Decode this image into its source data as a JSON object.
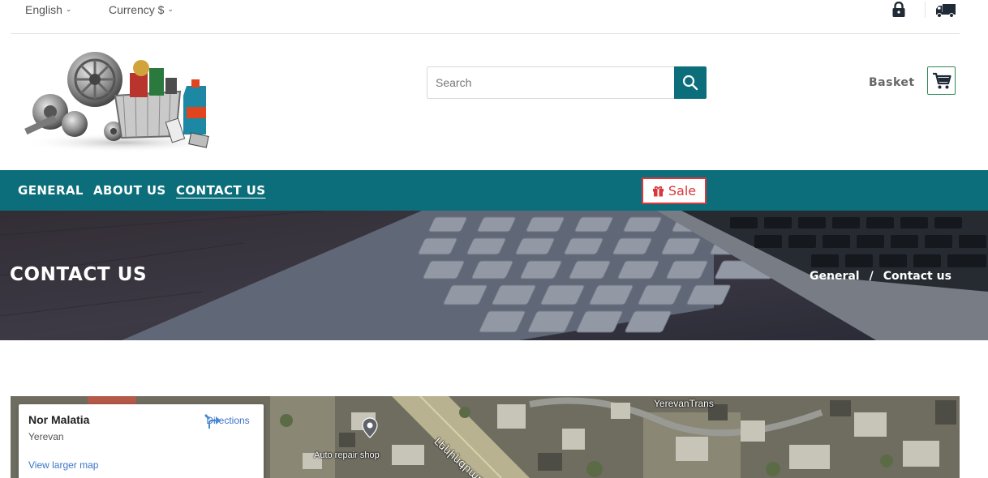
{
  "topbar": {
    "language": "English",
    "currency": "Currency $",
    "lock_icon": "lock-icon",
    "truck_icon": "truck-icon"
  },
  "header": {
    "search": {
      "placeholder": "Search",
      "value": ""
    },
    "basket_label": "Basket",
    "search_icon": "search-icon",
    "cart_icon": "cart-icon"
  },
  "nav": {
    "items": [
      {
        "label": "GENERAL"
      },
      {
        "label": "ABOUT US"
      },
      {
        "label": "CONTACT US",
        "active": true
      }
    ],
    "sale_label": "Sale",
    "sale_icon": "gift-icon"
  },
  "hero": {
    "title": "CONTACT US",
    "breadcrumb": {
      "home": "General",
      "separator": "/",
      "current": "Contact us"
    }
  },
  "map": {
    "place_name": "Nor Malatia",
    "place_city": "Yerevan",
    "directions_label": "Directions",
    "larger_map_label": "View larger map",
    "labels": {
      "auto_repair": "Auto repair shop",
      "yerevantrans": "YerevanTrans",
      "street": "Լենինգրադյան"
    }
  },
  "colors": {
    "primary": "#0b6e7a",
    "sale_red": "#d9363e",
    "cart_border": "#2e8a57",
    "link_blue": "#3a74c7"
  }
}
